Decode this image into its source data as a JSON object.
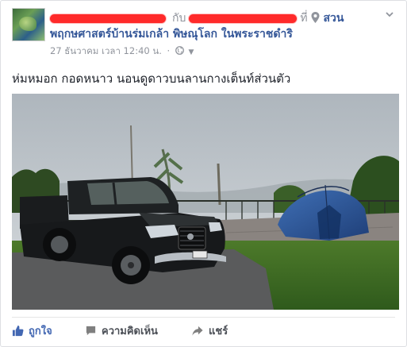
{
  "post": {
    "connector": "กับ",
    "at_word": "ที่",
    "place_part1": "สวน",
    "place_part2": "พฤกษศาสตร์บ้านร่มเกล้า พิษณุโลก ในพระราชดำริ",
    "timestamp": "27 ธันวาคม เวลา 12:40 น.",
    "separator": "·",
    "privacy_icon": "globe-icon",
    "caption": "ห่มหมอก กอดหนาว นอนดูดาวบนลานกางเต็นท์ส่วนตัว"
  },
  "actions": {
    "like_label": "ถูกใจ",
    "comment_label": "ความคิดเห็น",
    "share_label": "แชร์"
  },
  "colors": {
    "link": "#365899",
    "like_blue": "#4267b2",
    "redaction": "#ff2a2a",
    "meta_gray": "#90949c"
  }
}
